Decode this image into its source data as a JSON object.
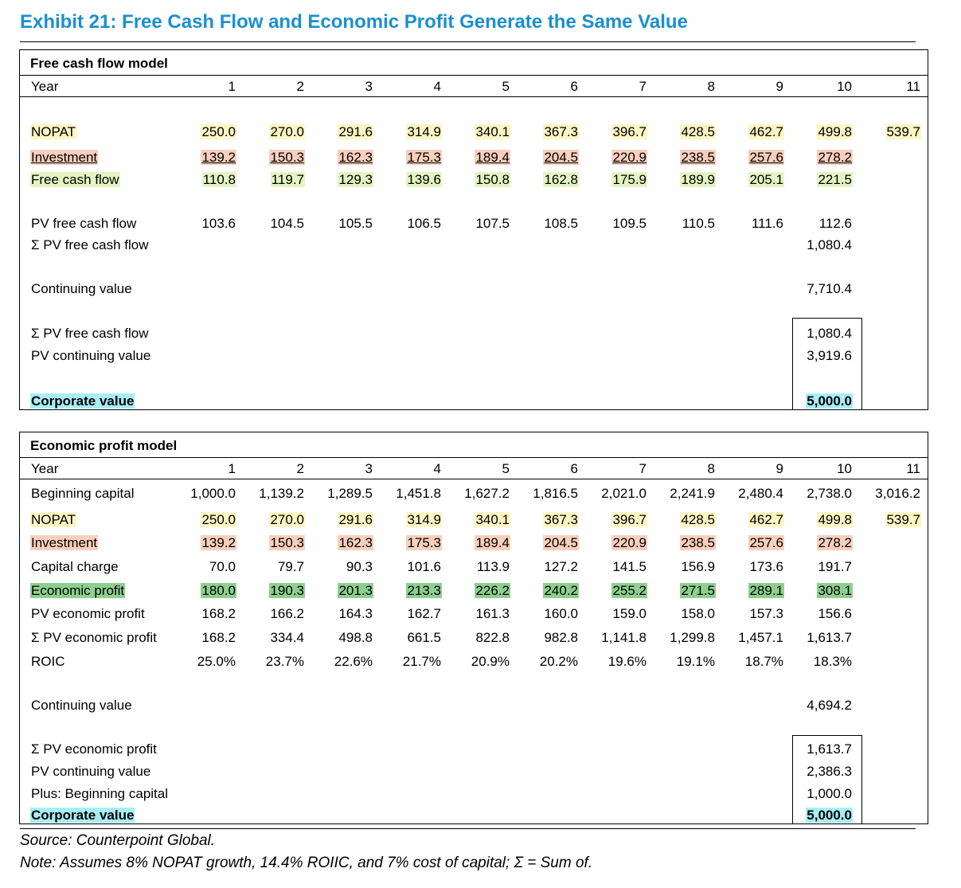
{
  "title": "Exhibit 21: Free Cash Flow and Economic Profit Generate the Same Value",
  "fcf_model": {
    "heading": "Free cash flow model",
    "years_label": "Year",
    "years": [
      "1",
      "2",
      "3",
      "4",
      "5",
      "6",
      "7",
      "8",
      "9",
      "10",
      "11"
    ],
    "nopat_label": "NOPAT",
    "nopat": [
      "250.0",
      "270.0",
      "291.6",
      "314.9",
      "340.1",
      "367.3",
      "396.7",
      "428.5",
      "462.7",
      "499.8",
      "539.7"
    ],
    "investment_label": "Investment",
    "investment": [
      "139.2",
      "150.3",
      "162.3",
      "175.3",
      "189.4",
      "204.5",
      "220.9",
      "238.5",
      "257.6",
      "278.2"
    ],
    "fcf_label": "Free cash flow",
    "fcf": [
      "110.8",
      "119.7",
      "129.3",
      "139.6",
      "150.8",
      "162.8",
      "175.9",
      "189.9",
      "205.1",
      "221.5"
    ],
    "pv_fcf_label": "PV free cash flow",
    "pv_fcf": [
      "103.6",
      "104.5",
      "105.5",
      "106.5",
      "107.5",
      "108.5",
      "109.5",
      "110.5",
      "111.6",
      "112.6"
    ],
    "sum_pv_fcf_label": "Σ PV free cash flow",
    "sum_pv_fcf": "1,080.4",
    "continuing_value_label": "Continuing value",
    "continuing_value": "7,710.4",
    "summary_sum_pv_fcf_label": "Σ PV free cash flow",
    "summary_sum_pv_fcf": "1,080.4",
    "pv_continuing_value_label": "PV continuing value",
    "pv_continuing_value": "3,919.6",
    "corporate_value_label": "Corporate value",
    "corporate_value": "5,000.0"
  },
  "ep_model": {
    "heading": "Economic profit model",
    "years_label": "Year",
    "years": [
      "1",
      "2",
      "3",
      "4",
      "5",
      "6",
      "7",
      "8",
      "9",
      "10",
      "11"
    ],
    "beginning_capital_label": "Beginning capital",
    "beginning_capital": [
      "1,000.0",
      "1,139.2",
      "1,289.5",
      "1,451.8",
      "1,627.2",
      "1,816.5",
      "2,021.0",
      "2,241.9",
      "2,480.4",
      "2,738.0",
      "3,016.2"
    ],
    "nopat_label": "NOPAT",
    "nopat": [
      "250.0",
      "270.0",
      "291.6",
      "314.9",
      "340.1",
      "367.3",
      "396.7",
      "428.5",
      "462.7",
      "499.8",
      "539.7"
    ],
    "investment_label": "Investment",
    "investment": [
      "139.2",
      "150.3",
      "162.3",
      "175.3",
      "189.4",
      "204.5",
      "220.9",
      "238.5",
      "257.6",
      "278.2"
    ],
    "capital_charge_label": "Capital charge",
    "capital_charge": [
      "70.0",
      "79.7",
      "90.3",
      "101.6",
      "113.9",
      "127.2",
      "141.5",
      "156.9",
      "173.6",
      "191.7"
    ],
    "ep_label": "Economic profit",
    "ep": [
      "180.0",
      "190.3",
      "201.3",
      "213.3",
      "226.2",
      "240.2",
      "255.2",
      "271.5",
      "289.1",
      "308.1"
    ],
    "pv_ep_label": "PV economic profit",
    "pv_ep": [
      "168.2",
      "166.2",
      "164.3",
      "162.7",
      "161.3",
      "160.0",
      "159.0",
      "158.0",
      "157.3",
      "156.6"
    ],
    "sum_pv_ep_label": "Σ PV economic profit",
    "sum_pv_ep": [
      "168.2",
      "334.4",
      "498.8",
      "661.5",
      "822.8",
      "982.8",
      "1,141.8",
      "1,299.8",
      "1,457.1",
      "1,613.7"
    ],
    "roic_label": "ROIC",
    "roic": [
      "25.0%",
      "23.7%",
      "22.6%",
      "21.7%",
      "20.9%",
      "20.2%",
      "19.6%",
      "19.1%",
      "18.7%",
      "18.3%"
    ],
    "continuing_value_label": "Continuing value",
    "continuing_value": "4,694.2",
    "summary_sum_pv_ep_label": "Σ PV economic profit",
    "summary_sum_pv_ep": "1,613.7",
    "pv_continuing_value_label": "PV continuing value",
    "pv_continuing_value": "2,386.3",
    "plus_beginning_capital_label": "Plus: Beginning capital",
    "plus_beginning_capital": "1,000.0",
    "corporate_value_label": "Corporate value",
    "corporate_value": "5,000.0"
  },
  "source": "Source: Counterpoint Global.",
  "note": "Note: Assumes 8% NOPAT growth, 14.4% ROIIC, and 7% cost of capital; Σ = Sum of."
}
